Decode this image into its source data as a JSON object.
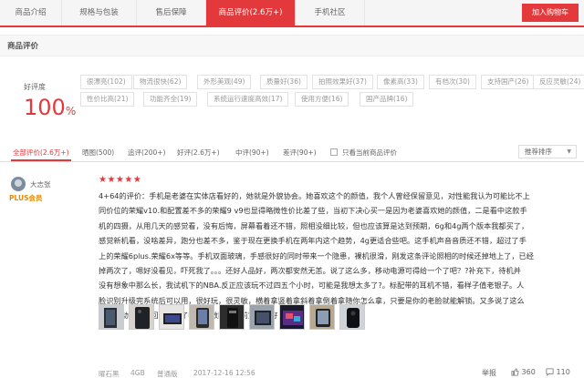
{
  "tabs": [
    {
      "label": "商品介绍"
    },
    {
      "label": "规格与包装"
    },
    {
      "label": "售后保障"
    },
    {
      "label": "商品评价(2.6万+)"
    },
    {
      "label": "手机社区"
    }
  ],
  "cart_button": "加入购物车",
  "section_title": "商品评价",
  "rate": {
    "label": "好评度",
    "value": "100",
    "unit": "%"
  },
  "tags": [
    {
      "label": "很漂亮(102)"
    },
    {
      "label": "物流很快(62)"
    },
    {
      "label": "外形美观(49)"
    },
    {
      "label": "质量好(36)"
    },
    {
      "label": "拍照效果好(37)"
    },
    {
      "label": "像素高(33)"
    },
    {
      "label": "有档次(30)"
    },
    {
      "label": "支持国产(26)"
    },
    {
      "label": "反应灵敏(24)"
    },
    {
      "label": "性价比高(21)"
    },
    {
      "label": "功能齐全(19)"
    },
    {
      "label": "系统运行速度高效(17)"
    },
    {
      "label": "使用方便(16)"
    },
    {
      "label": "国产品牌(16)"
    }
  ],
  "filters": [
    {
      "label": "全部评价(2.6万+)"
    },
    {
      "label": "晒图(500)"
    },
    {
      "label": "追评(200+)"
    },
    {
      "label": "好评(2.6万+)"
    },
    {
      "label": "中评(90+)"
    },
    {
      "label": "差评(90+)"
    }
  ],
  "only_current": "只看当前商品评价",
  "sort_select": "推荐排序",
  "review": {
    "username": "大志张",
    "badge": "PLUS会员",
    "stars": "★★★★★",
    "lines": [
      "4+64的评价：手机是老婆在实体店看好的，她就是外貌协会。她喜欢这个的颜值，我个人曾经保留意见，对性能我认为可能比不上",
      "同价位的荣耀v10.和配置差不多的荣耀9 v9也显得略微性价比差了些，当初下决心买一是因为老婆喜欢她的颜值，二是看中这款手",
      "机的四摄，从用几天的感觉看，没有后悔，屏幕看着还不错，照相没细比较，但也应该算是达到预期，6g和4g两个版本我都买了，",
      "感觉新机看，没啥差异，跑分也差不多，鉴于现在更换手机在两年内这个趋势，4g更适合些吧。这手机声音音质还不错，超过了手",
      "上的荣耀6plus.荣耀6x等等。手机双面玻璃，手感很好的同时带来一个隐患，裸机很滑，刚发这条评论照相的时候还掉地上了，已经",
      "掉两次了，嗯好没看见，吓死我了。。。还好人品好，两次都安然无恙。说了这么多，移动电源可得给一个了吧？?补充下，待机并",
      "没有想象中那么长，我试机下的NBA.反正应该玩不过四五个小时，可能是我想太多了?。标配带的耳机不错，看样子值老银子。人",
      "脸识别升级完系统后可以用，很好玩，很灵敏，横着拿竖着拿斜着拿倒着拿随你怎么拿，只要是你的老脸就能解锁。又多说了这么",
      "多，移动电源这回可以给了吧？字数限制了前置指纹好"
    ],
    "meta": {
      "color": "曜石黑",
      "ram": "4GB",
      "edition": "普通版",
      "date": "2017-12-16 12:56"
    },
    "report": "举报",
    "likes": "360",
    "comments": "110"
  },
  "colors": {
    "accent": "#e4393c",
    "plus": "#e68a00"
  }
}
